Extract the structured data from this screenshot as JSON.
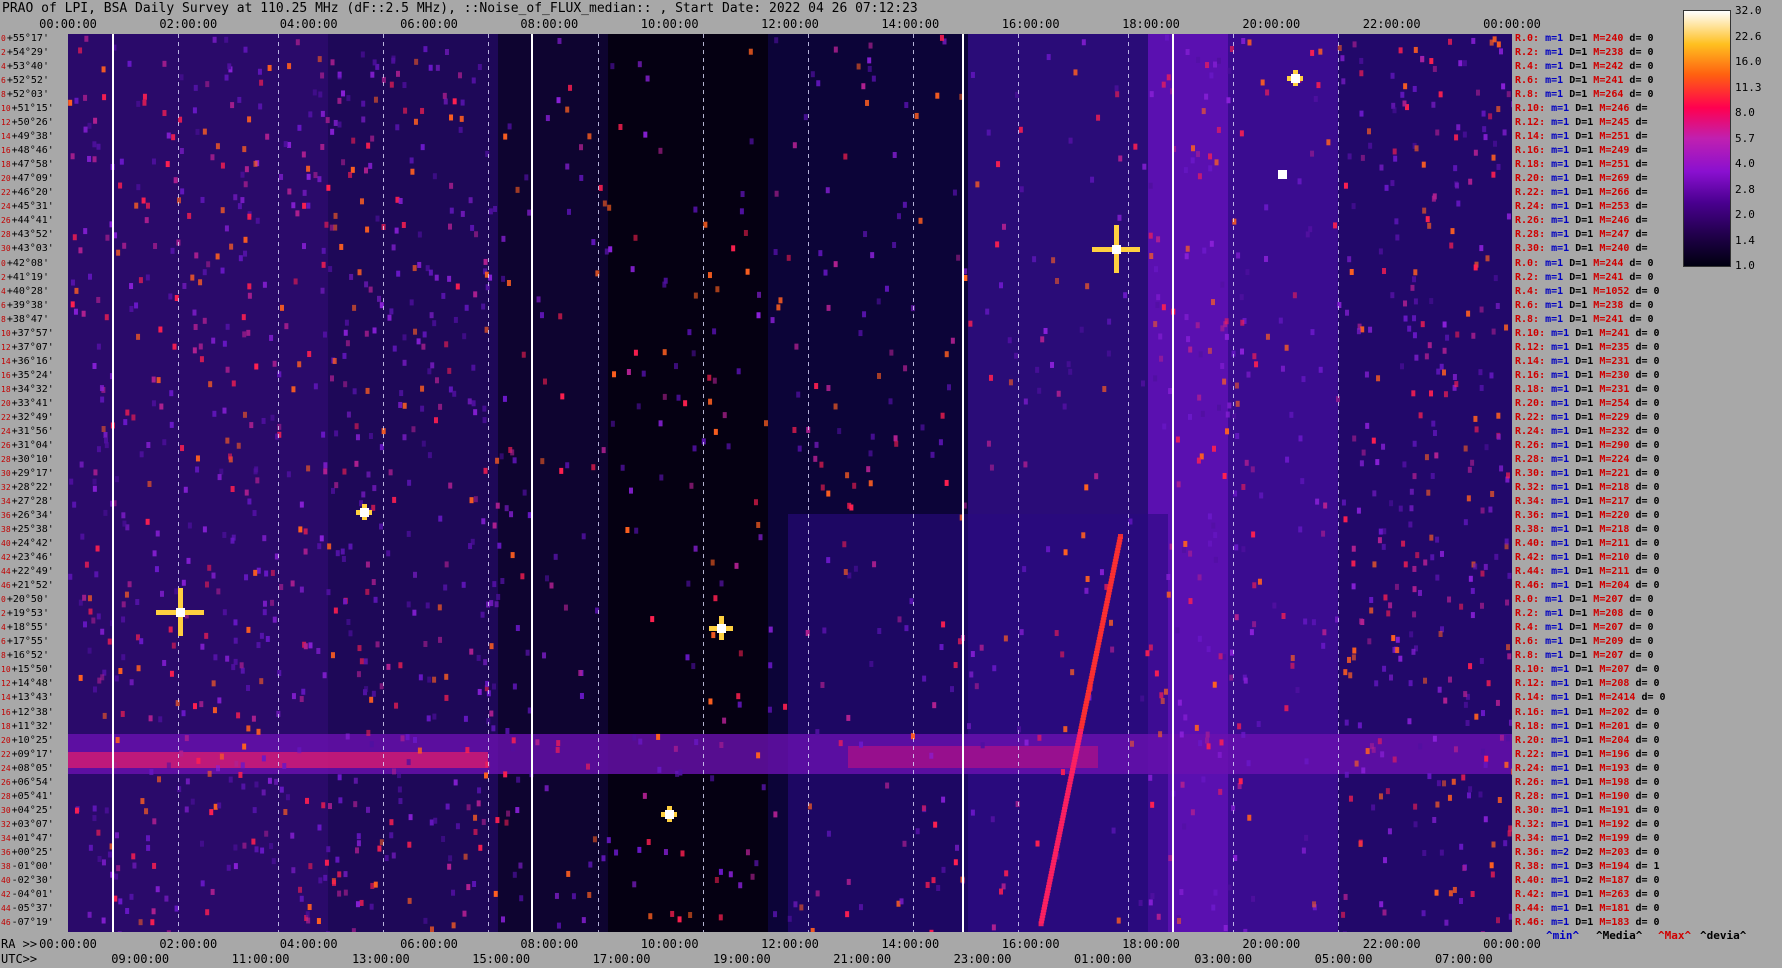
{
  "title": "PRAO of LPI, BSA Daily Survey at 110.25 MHz (dF::2.5 MHz), ::Noise_of_FLUX_median:: , Start Date: 2022 04 26 07:12:23",
  "top_axis": [
    "00:00:00",
    "02:00:00",
    "04:00:00",
    "06:00:00",
    "08:00:00",
    "10:00:00",
    "12:00:00",
    "14:00:00",
    "16:00:00",
    "18:00:00",
    "20:00:00",
    "22:00:00",
    "00:00:00"
  ],
  "ra_prefix": "RA >>",
  "ra_axis": [
    "00:00:00",
    "02:00:00",
    "04:00:00",
    "06:00:00",
    "08:00:00",
    "10:00:00",
    "12:00:00",
    "14:00:00",
    "16:00:00",
    "18:00:00",
    "20:00:00",
    "22:00:00",
    "00:00:00"
  ],
  "utc_prefix": "UTC>>",
  "utc_axis": [
    "09:00:00",
    "11:00:00",
    "13:00:00",
    "15:00:00",
    "17:00:00",
    "19:00:00",
    "21:00:00",
    "23:00:00",
    "01:00:00",
    "03:00:00",
    "05:00:00",
    "07:00:00"
  ],
  "colorbar_labels": [
    "32.0",
    "22.6",
    "16.0",
    "11.3",
    "8.0",
    "5.7",
    "4.0",
    "2.8",
    "2.0",
    "1.4",
    "1.0"
  ],
  "legend": {
    "min": "^min^",
    "media": "^Media^",
    "max": "^Max^",
    "devia": "^devia^"
  },
  "declinations": [
    {
      "i": "0",
      "d": "+55°17'"
    },
    {
      "i": "2",
      "d": "+54°29'"
    },
    {
      "i": "4",
      "d": "+53°40'"
    },
    {
      "i": "6",
      "d": "+52°52'"
    },
    {
      "i": "8",
      "d": "+52°03'"
    },
    {
      "i": "10",
      "d": "+51°15'"
    },
    {
      "i": "12",
      "d": "+50°26'"
    },
    {
      "i": "14",
      "d": "+49°38'"
    },
    {
      "i": "16",
      "d": "+48°46'"
    },
    {
      "i": "18",
      "d": "+47°58'"
    },
    {
      "i": "20",
      "d": "+47°09'"
    },
    {
      "i": "22",
      "d": "+46°20'"
    },
    {
      "i": "24",
      "d": "+45°31'"
    },
    {
      "i": "26",
      "d": "+44°41'"
    },
    {
      "i": "28",
      "d": "+43°52'"
    },
    {
      "i": "30",
      "d": "+43°03'"
    },
    {
      "i": "0",
      "d": "+42°08'"
    },
    {
      "i": "2",
      "d": "+41°19'"
    },
    {
      "i": "4",
      "d": "+40°28'"
    },
    {
      "i": "6",
      "d": "+39°38'"
    },
    {
      "i": "8",
      "d": "+38°47'"
    },
    {
      "i": "10",
      "d": "+37°57'"
    },
    {
      "i": "12",
      "d": "+37°07'"
    },
    {
      "i": "14",
      "d": "+36°16'"
    },
    {
      "i": "16",
      "d": "+35°24'"
    },
    {
      "i": "18",
      "d": "+34°32'"
    },
    {
      "i": "20",
      "d": "+33°41'"
    },
    {
      "i": "22",
      "d": "+32°49'"
    },
    {
      "i": "24",
      "d": "+31°56'"
    },
    {
      "i": "26",
      "d": "+31°04'"
    },
    {
      "i": "28",
      "d": "+30°10'"
    },
    {
      "i": "30",
      "d": "+29°17'"
    },
    {
      "i": "32",
      "d": "+28°22'"
    },
    {
      "i": "34",
      "d": "+27°28'"
    },
    {
      "i": "36",
      "d": "+26°34'"
    },
    {
      "i": "38",
      "d": "+25°38'"
    },
    {
      "i": "40",
      "d": "+24°42'"
    },
    {
      "i": "42",
      "d": "+23°46'"
    },
    {
      "i": "44",
      "d": "+22°49'"
    },
    {
      "i": "46",
      "d": "+21°52'"
    },
    {
      "i": "0",
      "d": "+20°50'"
    },
    {
      "i": "2",
      "d": "+19°53'"
    },
    {
      "i": "4",
      "d": "+18°55'"
    },
    {
      "i": "6",
      "d": "+17°55'"
    },
    {
      "i": "8",
      "d": "+16°52'"
    },
    {
      "i": "10",
      "d": "+15°50'"
    },
    {
      "i": "12",
      "d": "+14°48'"
    },
    {
      "i": "14",
      "d": "+13°43'"
    },
    {
      "i": "16",
      "d": "+12°38'"
    },
    {
      "i": "18",
      "d": "+11°32'"
    },
    {
      "i": "20",
      "d": "+10°25'"
    },
    {
      "i": "22",
      "d": "+09°17'"
    },
    {
      "i": "24",
      "d": "+08°05'"
    },
    {
      "i": "26",
      "d": "+06°54'"
    },
    {
      "i": "28",
      "d": "+05°41'"
    },
    {
      "i": "30",
      "d": "+04°25'"
    },
    {
      "i": "32",
      "d": "+03°07'"
    },
    {
      "i": "34",
      "d": "+01°47'"
    },
    {
      "i": "36",
      "d": "+00°25'"
    },
    {
      "i": "38",
      "d": "-01°00'"
    },
    {
      "i": "40",
      "d": "-02°30'"
    },
    {
      "i": "42",
      "d": "-04°01'"
    },
    {
      "i": "44",
      "d": "-05°37'"
    },
    {
      "i": "46",
      "d": "-07°19'"
    }
  ],
  "rays": [
    {
      "r": "R.0:",
      "m": "m=1",
      "D": "D=1",
      "M": "M=240",
      "d": "d= 0"
    },
    {
      "r": "R.2:",
      "m": "m=1",
      "D": "D=1",
      "M": "M=238",
      "d": "d= 0"
    },
    {
      "r": "R.4:",
      "m": "m=1",
      "D": "D=1",
      "M": "M=242",
      "d": "d= 0"
    },
    {
      "r": "R.6:",
      "m": "m=1",
      "D": "D=1",
      "M": "M=241",
      "d": "d= 0"
    },
    {
      "r": "R.8:",
      "m": "m=1",
      "D": "D=1",
      "M": "M=264",
      "d": "d= 0"
    },
    {
      "r": "R.10:",
      "m": "m=1",
      "D": "D=1",
      "M": "M=246",
      "d": "d="
    },
    {
      "r": "R.12:",
      "m": "m=1",
      "D": "D=1",
      "M": "M=245",
      "d": "d="
    },
    {
      "r": "R.14:",
      "m": "m=1",
      "D": "D=1",
      "M": "M=251",
      "d": "d="
    },
    {
      "r": "R.16:",
      "m": "m=1",
      "D": "D=1",
      "M": "M=249",
      "d": "d="
    },
    {
      "r": "R.18:",
      "m": "m=1",
      "D": "D=1",
      "M": "M=251",
      "d": "d="
    },
    {
      "r": "R.20:",
      "m": "m=1",
      "D": "D=1",
      "M": "M=269",
      "d": "d="
    },
    {
      "r": "R.22:",
      "m": "m=1",
      "D": "D=1",
      "M": "M=266",
      "d": "d="
    },
    {
      "r": "R.24:",
      "m": "m=1",
      "D": "D=1",
      "M": "M=253",
      "d": "d="
    },
    {
      "r": "R.26:",
      "m": "m=1",
      "D": "D=1",
      "M": "M=246",
      "d": "d="
    },
    {
      "r": "R.28:",
      "m": "m=1",
      "D": "D=1",
      "M": "M=247",
      "d": "d="
    },
    {
      "r": "R.30:",
      "m": "m=1",
      "D": "D=1",
      "M": "M=240",
      "d": "d="
    },
    {
      "r": "R.0:",
      "m": "m=1",
      "D": "D=1",
      "M": "M=244",
      "d": "d= 0"
    },
    {
      "r": "R.2:",
      "m": "m=1",
      "D": "D=1",
      "M": "M=241",
      "d": "d= 0"
    },
    {
      "r": "R.4:",
      "m": "m=1",
      "D": "D=1",
      "M": "M=1052",
      "d": "d= 0"
    },
    {
      "r": "R.6:",
      "m": "m=1",
      "D": "D=1",
      "M": "M=238",
      "d": "d= 0"
    },
    {
      "r": "R.8:",
      "m": "m=1",
      "D": "D=1",
      "M": "M=241",
      "d": "d= 0"
    },
    {
      "r": "R.10:",
      "m": "m=1",
      "D": "D=1",
      "M": "M=241",
      "d": "d= 0"
    },
    {
      "r": "R.12:",
      "m": "m=1",
      "D": "D=1",
      "M": "M=235",
      "d": "d= 0"
    },
    {
      "r": "R.14:",
      "m": "m=1",
      "D": "D=1",
      "M": "M=231",
      "d": "d= 0"
    },
    {
      "r": "R.16:",
      "m": "m=1",
      "D": "D=1",
      "M": "M=230",
      "d": "d= 0"
    },
    {
      "r": "R.18:",
      "m": "m=1",
      "D": "D=1",
      "M": "M=231",
      "d": "d= 0"
    },
    {
      "r": "R.20:",
      "m": "m=1",
      "D": "D=1",
      "M": "M=254",
      "d": "d= 0"
    },
    {
      "r": "R.22:",
      "m": "m=1",
      "D": "D=1",
      "M": "M=229",
      "d": "d= 0"
    },
    {
      "r": "R.24:",
      "m": "m=1",
      "D": "D=1",
      "M": "M=232",
      "d": "d= 0"
    },
    {
      "r": "R.26:",
      "m": "m=1",
      "D": "D=1",
      "M": "M=290",
      "d": "d= 0"
    },
    {
      "r": "R.28:",
      "m": "m=1",
      "D": "D=1",
      "M": "M=224",
      "d": "d= 0"
    },
    {
      "r": "R.30:",
      "m": "m=1",
      "D": "D=1",
      "M": "M=221",
      "d": "d= 0"
    },
    {
      "r": "R.32:",
      "m": "m=1",
      "D": "D=1",
      "M": "M=218",
      "d": "d= 0"
    },
    {
      "r": "R.34:",
      "m": "m=1",
      "D": "D=1",
      "M": "M=217",
      "d": "d= 0"
    },
    {
      "r": "R.36:",
      "m": "m=1",
      "D": "D=1",
      "M": "M=220",
      "d": "d= 0"
    },
    {
      "r": "R.38:",
      "m": "m=1",
      "D": "D=1",
      "M": "M=218",
      "d": "d= 0"
    },
    {
      "r": "R.40:",
      "m": "m=1",
      "D": "D=1",
      "M": "M=211",
      "d": "d= 0"
    },
    {
      "r": "R.42:",
      "m": "m=1",
      "D": "D=1",
      "M": "M=210",
      "d": "d= 0"
    },
    {
      "r": "R.44:",
      "m": "m=1",
      "D": "D=1",
      "M": "M=211",
      "d": "d= 0"
    },
    {
      "r": "R.46:",
      "m": "m=1",
      "D": "D=1",
      "M": "M=204",
      "d": "d= 0"
    },
    {
      "r": "R.0:",
      "m": "m=1",
      "D": "D=1",
      "M": "M=207",
      "d": "d= 0"
    },
    {
      "r": "R.2:",
      "m": "m=1",
      "D": "D=1",
      "M": "M=208",
      "d": "d= 0"
    },
    {
      "r": "R.4:",
      "m": "m=1",
      "D": "D=1",
      "M": "M=207",
      "d": "d= 0"
    },
    {
      "r": "R.6:",
      "m": "m=1",
      "D": "D=1",
      "M": "M=209",
      "d": "d= 0"
    },
    {
      "r": "R.8:",
      "m": "m=1",
      "D": "D=1",
      "M": "M=207",
      "d": "d= 0"
    },
    {
      "r": "R.10:",
      "m": "m=1",
      "D": "D=1",
      "M": "M=207",
      "d": "d= 0"
    },
    {
      "r": "R.12:",
      "m": "m=1",
      "D": "D=1",
      "M": "M=208",
      "d": "d= 0"
    },
    {
      "r": "R.14:",
      "m": "m=1",
      "D": "D=1",
      "M": "M=2414",
      "d": "d= 0"
    },
    {
      "r": "R.16:",
      "m": "m=1",
      "D": "D=1",
      "M": "M=202",
      "d": "d= 0"
    },
    {
      "r": "R.18:",
      "m": "m=1",
      "D": "D=1",
      "M": "M=201",
      "d": "d= 0"
    },
    {
      "r": "R.20:",
      "m": "m=1",
      "D": "D=1",
      "M": "M=204",
      "d": "d= 0"
    },
    {
      "r": "R.22:",
      "m": "m=1",
      "D": "D=1",
      "M": "M=196",
      "d": "d= 0"
    },
    {
      "r": "R.24:",
      "m": "m=1",
      "D": "D=1",
      "M": "M=193",
      "d": "d= 0"
    },
    {
      "r": "R.26:",
      "m": "m=1",
      "D": "D=1",
      "M": "M=198",
      "d": "d= 0"
    },
    {
      "r": "R.28:",
      "m": "m=1",
      "D": "D=1",
      "M": "M=190",
      "d": "d= 0"
    },
    {
      "r": "R.30:",
      "m": "m=1",
      "D": "D=1",
      "M": "M=191",
      "d": "d= 0"
    },
    {
      "r": "R.32:",
      "m": "m=1",
      "D": "D=1",
      "M": "M=192",
      "d": "d= 0"
    },
    {
      "r": "R.34:",
      "m": "m=1",
      "D": "D=2",
      "M": "M=199",
      "d": "d= 0"
    },
    {
      "r": "R.36:",
      "m": "m=2",
      "D": "D=2",
      "M": "M=203",
      "d": "d= 0"
    },
    {
      "r": "R.38:",
      "m": "m=1",
      "D": "D=3",
      "M": "M=194",
      "d": "d= 1"
    },
    {
      "r": "R.40:",
      "m": "m=1",
      "D": "D=2",
      "M": "M=187",
      "d": "d= 0"
    },
    {
      "r": "R.42:",
      "m": "m=1",
      "D": "D=1",
      "M": "M=263",
      "d": "d= 0"
    },
    {
      "r": "R.44:",
      "m": "m=1",
      "D": "D=1",
      "M": "M=181",
      "d": "d= 0"
    },
    {
      "r": "R.46:",
      "m": "m=1",
      "D": "D=1",
      "M": "M=183",
      "d": "d= 0"
    }
  ]
}
